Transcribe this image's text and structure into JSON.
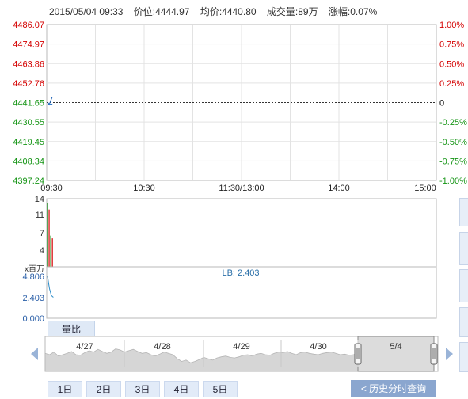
{
  "header": {
    "datetime": "2015/05/04 09:33",
    "price": "价位:4444.97",
    "avg": "均价:4440.80",
    "volume": "成交量:89万",
    "change": "涨幅:0.07%"
  },
  "colors": {
    "up": "#d40000",
    "down": "#149414",
    "neutral": "#000000",
    "grid": "#e3e3e3",
    "avg": "#2a78c8",
    "price": "#1a5fb4",
    "nav_fill": "#d6d6d6",
    "nav_sel": "#c4c4c4",
    "button_bg": "#dfe9f6"
  },
  "chart_data": [
    {
      "type": "line",
      "name": "price-chart",
      "ylim": [
        4397.24,
        4486.07
      ],
      "y_ticks_left": [
        "4486.07",
        "4474.97",
        "4463.86",
        "4452.76",
        "4441.65",
        "4430.55",
        "4419.45",
        "4408.34",
        "4397.24"
      ],
      "y_ticks_right": [
        "1.00%",
        "0.75%",
        "0.50%",
        "0.25%",
        "0",
        "-0.25%",
        "-0.50%",
        "-0.75%",
        "-1.00%"
      ],
      "x_ticks": [
        "09:30",
        "10:30",
        "11:30/13:00",
        "14:00",
        "15:00"
      ],
      "base_price": 4441.65,
      "series": [
        {
          "values": [
            4441.65,
            4440.4,
            4442.8,
            4444.97
          ]
        },
        {
          "values": [
            4441.65,
            4441.0,
            4440.6,
            4440.8
          ]
        }
      ]
    },
    {
      "type": "bar",
      "name": "volume-chart",
      "ylim": [
        0,
        14
      ],
      "y_ticks": [
        "14",
        "11",
        "7",
        "4"
      ],
      "ylabel": "x百万",
      "values": [
        14,
        12.5,
        6.8,
        6.2
      ]
    },
    {
      "type": "line",
      "name": "lb-chart",
      "label": "LB: 2.403",
      "ylim": [
        0,
        4.806
      ],
      "y_ticks": [
        "4.806",
        "2.403",
        "0.000"
      ],
      "values": [
        4.806,
        3.4,
        2.6,
        2.403
      ]
    }
  ],
  "tabs": {
    "volume_ratio": "量比"
  },
  "navigator": {
    "dates": [
      "4/27",
      "4/28",
      "4/29",
      "4/30",
      "5/4"
    ],
    "profile": [
      0.55,
      0.5,
      0.6,
      0.45,
      0.5,
      0.55,
      0.62,
      0.5,
      0.48,
      0.58,
      0.65,
      0.6,
      0.7,
      0.62,
      0.55,
      0.6,
      0.72,
      0.68,
      0.6,
      0.65,
      0.7,
      0.62,
      0.55,
      0.58,
      0.5,
      0.45,
      0.52,
      0.6,
      0.55,
      0.5,
      0.35,
      0.25,
      0.3,
      0.2,
      0.25,
      0.32,
      0.4,
      0.35,
      0.3,
      0.38,
      0.42,
      0.45,
      0.4,
      0.38,
      0.42,
      0.48,
      0.5,
      0.45,
      0.52,
      0.55,
      0.5,
      0.48,
      0.55,
      0.6,
      0.58,
      0.62,
      0.55,
      0.5,
      0.58,
      0.6,
      0.55,
      0.52,
      0.5,
      0.55,
      0.58,
      0.6,
      0.55,
      0.5,
      0.52,
      0.48,
      0.5,
      0.55
    ]
  },
  "days": [
    "1日",
    "2日",
    "3日",
    "4日",
    "5日"
  ],
  "history_button": "< 历史分时查询"
}
